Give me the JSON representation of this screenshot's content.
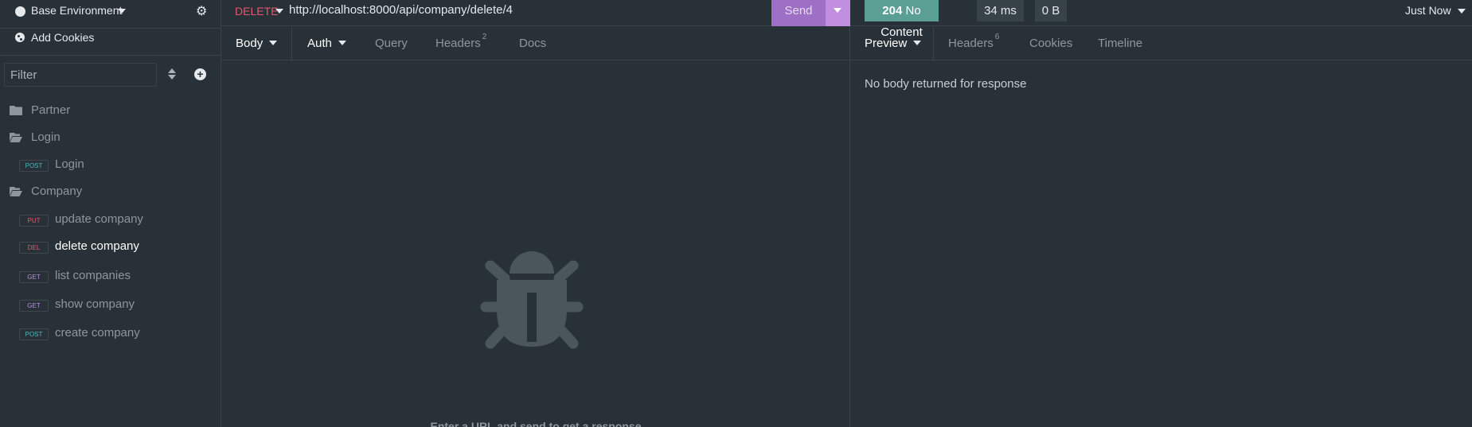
{
  "sidebar": {
    "environment": "Base Environment",
    "add_cookies": "Add Cookies",
    "filter_placeholder": "Filter",
    "folders": [
      {
        "label": "Partner",
        "expanded": false
      },
      {
        "label": "Login",
        "expanded": true
      },
      {
        "label": "Company",
        "expanded": true
      }
    ],
    "requests": [
      {
        "method": "POST",
        "label": "Login",
        "color": "#4fb8c1"
      },
      {
        "method": "PUT",
        "label": "update company",
        "color": "#e3586b"
      },
      {
        "method": "DEL",
        "label": "delete company",
        "color": "#e3586b",
        "active": true
      },
      {
        "method": "GET",
        "label": "list companies",
        "color": "#b98ee0"
      },
      {
        "method": "GET",
        "label": "show company",
        "color": "#b98ee0"
      },
      {
        "method": "POST",
        "label": "create company",
        "color": "#4fb8c1"
      }
    ]
  },
  "request": {
    "method": "DELETE",
    "url": "http://localhost:8000/api/company/delete/4",
    "send_label": "Send",
    "tabs": {
      "body": "Body",
      "auth": "Auth",
      "query": "Query",
      "headers": "Headers",
      "headers_count": "2",
      "docs": "Docs"
    },
    "empty_hint": "Enter a URL and send to get a response"
  },
  "response": {
    "status_code": "204",
    "status_text": "No Content",
    "time": "34 ms",
    "size": "0 B",
    "timestamp": "Just Now",
    "tabs": {
      "preview": "Preview",
      "headers": "Headers",
      "headers_count": "6",
      "cookies": "Cookies",
      "timeline": "Timeline"
    },
    "no_body": "No body returned for response"
  },
  "colors": {
    "background": "#283137",
    "send_button": "#9d6fc5",
    "status_success": "#5b9e94",
    "delete_method": "#e3586b"
  }
}
